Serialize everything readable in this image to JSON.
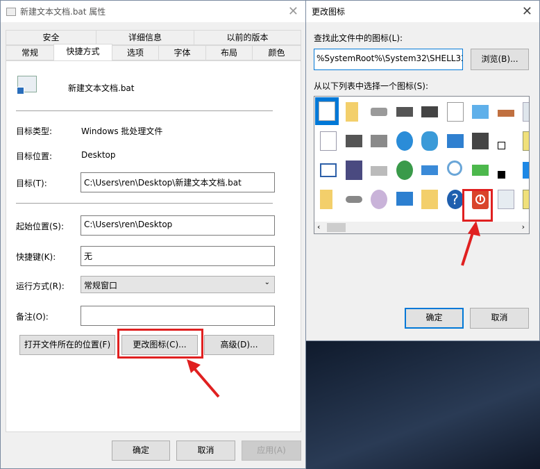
{
  "props_dialog": {
    "title": "新建文本文档.bat 属性",
    "tabs_row1": [
      "安全",
      "详细信息",
      "以前的版本"
    ],
    "tabs_row2": [
      "常规",
      "快捷方式",
      "选项",
      "字体",
      "布局",
      "颜色"
    ],
    "active_tab": "快捷方式",
    "file_name": "新建文本文档.bat",
    "target_type_label": "目标类型:",
    "target_type_value": "Windows 批处理文件",
    "target_location_label": "目标位置:",
    "target_location_value": "Desktop",
    "target_label": "目标(T):",
    "target_value": "C:\\Users\\ren\\Desktop\\新建文本文档.bat",
    "start_in_label": "起始位置(S):",
    "start_in_value": "C:\\Users\\ren\\Desktop",
    "hotkey_label": "快捷键(K):",
    "hotkey_value": "无",
    "run_label": "运行方式(R):",
    "run_value": "常规窗口",
    "comment_label": "备注(O):",
    "comment_value": "",
    "open_location_button": "打开文件所在的位置(F)",
    "change_icon_button": "更改图标(C)...",
    "advanced_button": "高级(D)...",
    "ok": "确定",
    "cancel": "取消",
    "apply": "应用(A)"
  },
  "icon_dialog": {
    "title": "更改图标",
    "find_label": "查找此文件中的图标(L):",
    "path_value": "%SystemRoot%\\System32\\SHELL32.",
    "browse_button": "浏览(B)...",
    "select_label": "从以下列表中选择一个图标(S):",
    "icons": [
      [
        "document",
        "folder",
        "drive",
        "chip",
        "printer",
        "doc-clock",
        "display",
        "hand",
        "recycle-full"
      ],
      [
        "text-doc",
        "floppy-drive",
        "network-drive",
        "ie-globe",
        "globe-monitor",
        "control-panel",
        "monitor-moon",
        "shortcut-arrow",
        "network-folder"
      ],
      [
        "window",
        "floppy-h",
        "drive-x",
        "globe-mouse",
        "network",
        "magnifier",
        "green-arrow",
        "overlay-clock",
        "blue-square"
      ],
      [
        "folder",
        "drive-flat",
        "cd-drive",
        "monitor",
        "grid-folder",
        "help",
        "power",
        "recycle-empty",
        "tools-folder"
      ]
    ],
    "highlighted_icon": "power",
    "ok": "确定",
    "cancel": "取消"
  },
  "colors": {
    "highlight": "#e02020",
    "accent": "#0078d7"
  }
}
